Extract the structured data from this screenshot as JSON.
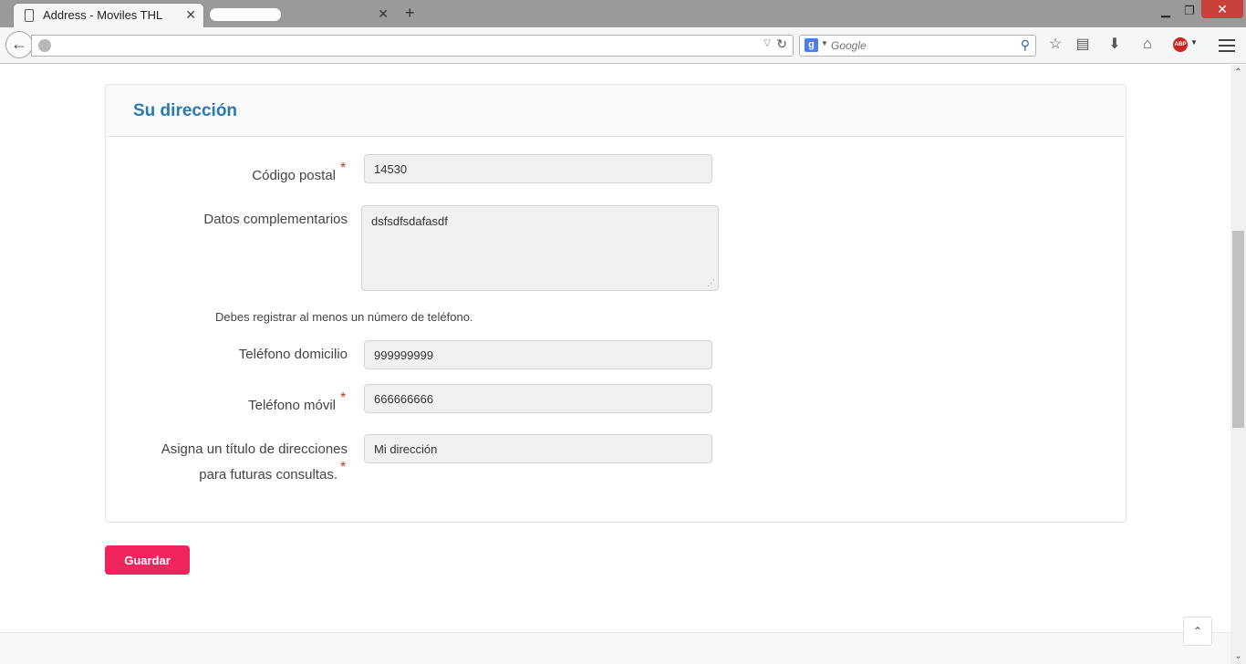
{
  "browser": {
    "active_tab_title": "Address - Moviles THL",
    "search_placeholder": "Google",
    "search_engine_letter": "g",
    "abp_label": "ABP"
  },
  "form": {
    "section_title": "Su dirección",
    "postal_code_label": "Código postal",
    "postal_code_value": "14530",
    "extra_data_label": "Datos complementarios",
    "extra_data_value": "dsfsdfsdafasdf",
    "phone_help": "Debes registrar al menos un número de teléfono.",
    "home_phone_label": "Teléfono domicilio",
    "home_phone_value": "999999999",
    "mobile_phone_label": "Teléfono móvil",
    "mobile_phone_value": "666666666",
    "alias_label_line1": "Asigna un título de direcciones",
    "alias_label_line2": "para futuras consultas.",
    "alias_value": "Mi dirección",
    "required_mark": "*"
  },
  "actions": {
    "save_label": "Guardar"
  },
  "colors": {
    "accent": "#2a7ab0",
    "button": "#f1245e",
    "required": "#c0392b"
  }
}
